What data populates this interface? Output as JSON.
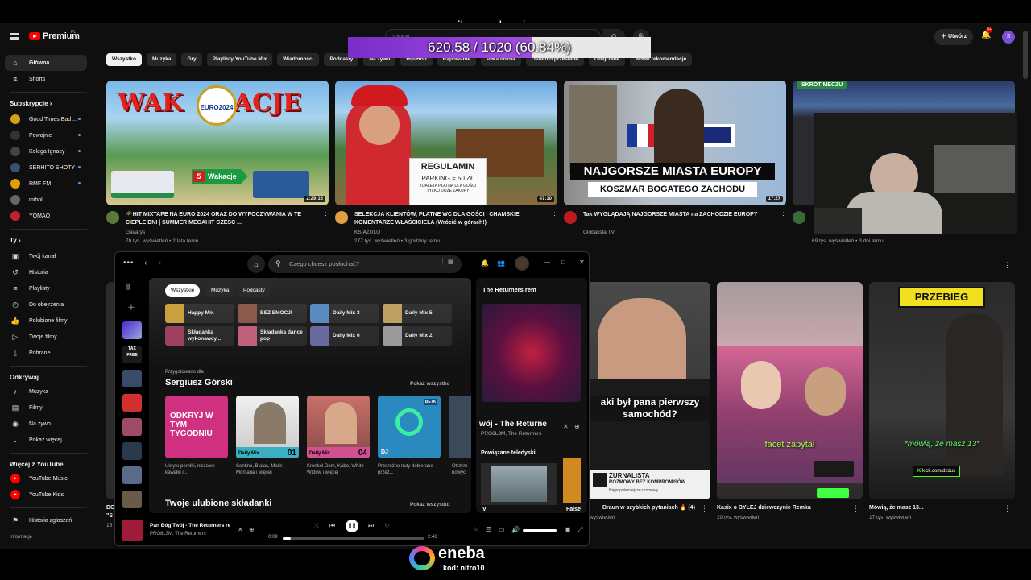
{
  "overlay": {
    "banner": "na miłe spędzenie czasu",
    "goal_text": "620.58 / 1020 (60.84%)",
    "goal_fraction": 0.6084,
    "sponsor": "eneba",
    "sponsor_code": "kod: nitro10"
  },
  "youtube": {
    "brand": "Premium",
    "brand_region": "PL",
    "search_placeholder": "Szukaj",
    "create_label": "Utwórz",
    "notification_count": "9+",
    "avatar_letter": "S",
    "sidebar": {
      "main": [
        {
          "label": "Główna",
          "icon": "home-icon",
          "glyph": "⌂"
        },
        {
          "label": "Shorts",
          "icon": "shorts-icon",
          "glyph": "↯"
        }
      ],
      "subs_title": "Subskrypcje",
      "subs": [
        {
          "label": "Good Times Bad ...",
          "color": "#d4a017",
          "live": true
        },
        {
          "label": "Powojnie",
          "color": "#333",
          "live": true
        },
        {
          "label": "Kolega Ignacy",
          "color": "#444",
          "live": true
        },
        {
          "label": "SERHITO SHOTY",
          "color": "#3a5070",
          "live": true
        },
        {
          "label": "RMF FM",
          "color": "#e0a000",
          "live": true
        },
        {
          "label": "mihol",
          "color": "#666",
          "live": false
        },
        {
          "label": "YOMAO",
          "color": "#c02030",
          "live": false
        }
      ],
      "you_title": "Ty",
      "you": [
        {
          "label": "Twój kanał",
          "glyph": "▣"
        },
        {
          "label": "Historia",
          "glyph": "↺"
        },
        {
          "label": "Playlisty",
          "glyph": "≡"
        },
        {
          "label": "Do obejrzenia",
          "glyph": "◷"
        },
        {
          "label": "Polubione filmy",
          "glyph": "👍"
        },
        {
          "label": "Twoje filmy",
          "glyph": "▷"
        },
        {
          "label": "Pobrane",
          "glyph": "⤓"
        }
      ],
      "explore_title": "Odkrywaj",
      "explore": [
        {
          "label": "Muzyka",
          "glyph": "♪"
        },
        {
          "label": "Filmy",
          "glyph": "▤"
        },
        {
          "label": "Na żywo",
          "glyph": "◉"
        },
        {
          "label": "Pokaż więcej",
          "glyph": "⌄"
        }
      ],
      "more_title": "Więcej z YouTube",
      "more": [
        {
          "label": "YouTube Music",
          "color": "#f00"
        },
        {
          "label": "YouTube Kids",
          "color": "#f00"
        }
      ],
      "report": "Historia zgłoszeń",
      "info": "Informacje"
    },
    "chips": [
      "Wszystko",
      "Muzyka",
      "Gry",
      "Playlisty YouTube Mix",
      "Wiadomości",
      "Podcasty",
      "Na żywo",
      "Hip-Hop",
      "Rapowanie",
      "Piłka nożna",
      "Ostatnio przesłane",
      "Obejrzane",
      "Nowe rekomendacje"
    ],
    "videos_row1": [
      {
        "title": "🌴HIT MIXTAPE NA EURO 2024 ORAZ DO WYPOCZYWANIA W TE CIEPLE DNI | SUMMER MEGAHIT CZESC ...",
        "channel": "Gavarys",
        "meta": "70 tys. wyświetleń • 2 lata temu",
        "duration": "2:29:16",
        "thumb_text": "WAK      ACJE",
        "badge": "Wakacje",
        "badge_num": "5"
      },
      {
        "title": "SELEKCJA KLIENTÓW, PŁATNE WC DLA GOŚCI I CHAMSKIE KOMENTARZE WŁAŚCICIELA (Wrócić w górach!)",
        "channel": "KSIĄŻULO",
        "meta": "277 tys. wyświetleń • 3 godziny temu",
        "duration": "47:10",
        "sign": "REGULAMIN",
        "sign2": "PARKING = 50 ZŁ",
        "sign3": "TOALETA PŁATNA DLA GOŚCI",
        "sign4": "TYLKO DUŻE ZAKUPY"
      },
      {
        "title": "Tak WYGLĄDAJĄ NAJGORSZE MIASTA na ZACHODZIE EUROPY",
        "channel": "Globalista TV",
        "meta": "70 tys. wyświetleń • 3 dni temu",
        "duration": "17:27",
        "line1": "NAJGORSZE MIASTA EUROPY",
        "line2": "KOSZMAR BOGATEGO ZACHODU"
      },
      {
        "title": "",
        "channel": "",
        "meta": "69 tys. wyświetleń • 3 dni temu",
        "duration": "",
        "tag": "SKRÓT MECZU"
      }
    ],
    "videos_row2": [
      {
        "title": "aki był pana pierwszy samochód?",
        "caption": "ŻURNALISTA",
        "caption2": "ROZMOWY BEZ KOMPROMISÓW",
        "caption3": "Najpopularniejsze rozmowy",
        "vtitle": "Braun w szybkich pytaniach 🔥 (4)",
        "meta": "wyświetleń"
      },
      {
        "caption": "facet zapytał",
        "vtitle": "Kasix o BYŁEJ dziewczynie Remka",
        "meta": "20 tys. wyświetleń"
      },
      {
        "tag": "PRZEBIEG",
        "caption": "*mówią, że masz 13*",
        "link": "kick.com/dzdus",
        "vtitle": "Mówią, że masz 13...",
        "meta": "17 tys. wyświetleń"
      }
    ],
    "left_peek": [
      "DO",
      "\"S",
      "15"
    ]
  },
  "spotify": {
    "search_placeholder": "Czego chcesz posłuchać?",
    "filters": [
      "Wszystkie",
      "Muzyka",
      "Podcasty"
    ],
    "tiles": [
      {
        "label": "Happy Mix",
        "color": "#c8a040"
      },
      {
        "label": "BEZ EMOCJI",
        "color": "#8a5a4a"
      },
      {
        "label": "Daily Mix 3",
        "color": "#5a8ac0"
      },
      {
        "label": "Daily Mix 5",
        "color": "#c0a060"
      },
      {
        "label": "Składanka wykonawcy...",
        "color": "#a04060"
      },
      {
        "label": "Składanka dance pop",
        "color": "#c0607a"
      },
      {
        "label": "Daily Mix 6",
        "color": "#6a6aa0"
      },
      {
        "label": "Daily Mix 2",
        "color": "#9a9a9a"
      }
    ],
    "made_for": "Przygotowano dla",
    "user_name": "Sergiusz Górski",
    "show_all": "Pokaż wszystko",
    "cards": [
      {
        "label": "Ukryte perełki, niszowe kawałki i...",
        "art_text": "ODKRYJ W TYM TYGODNIU",
        "color": "#d03080"
      },
      {
        "label": "Sentino, Białas, Malik Montana i więcej",
        "tag": "Daily Mix",
        "num": "01",
        "color": "#3ab0c0"
      },
      {
        "label": "Kronkel Dom, Kabe, White Widow i więcej",
        "tag": "Daily Mix",
        "num": "04",
        "color": "#d05090"
      },
      {
        "label": "Przeróżne nuty dobierane przez...",
        "tag": "DJ",
        "badge": "BETA",
        "color": "#2a8ac0"
      },
      {
        "label": "Otrzym nowyc",
        "color": "#3a4a5a"
      }
    ],
    "fav_title": "Twoje ulubione składanki",
    "right": {
      "header": "The Returners rem",
      "now_title": "wój - The Returne",
      "now_artist": "PRO8L3M, The Returners",
      "related": "Powiązane teledyski",
      "related_caption": "V",
      "related_caption2": "False"
    },
    "player": {
      "track": "Pan Bóg Twój - The Returners re",
      "artist": "PRO8L3M, The Returners",
      "elapsed": "0:09",
      "total": "2:46",
      "progress": 0.054
    }
  }
}
